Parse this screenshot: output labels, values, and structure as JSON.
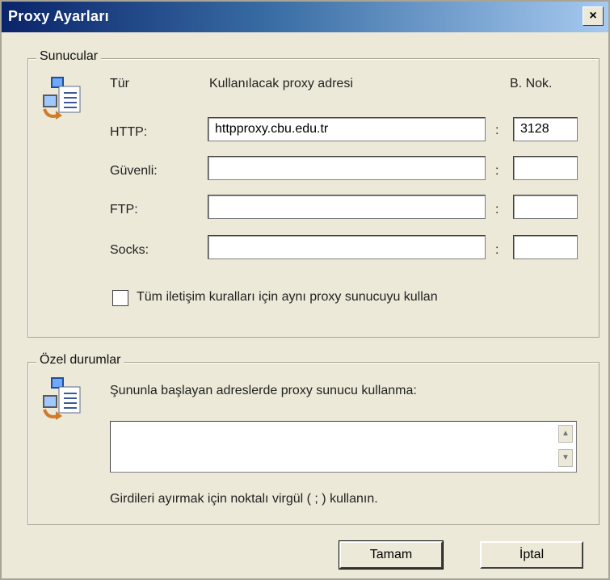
{
  "window": {
    "title": "Proxy Ayarları",
    "close_glyph": "×"
  },
  "servers": {
    "legend": "Sunucular",
    "icon": "proxy-settings-icon",
    "headers": {
      "type": "Tür",
      "address": "Kullanılacak proxy adresi",
      "port": "B. Nok."
    },
    "rows": [
      {
        "label": "HTTP:",
        "address": "httpproxy.cbu.edu.tr",
        "port": "3128"
      },
      {
        "label": "Güvenli:",
        "address": "",
        "port": ""
      },
      {
        "label": "FTP:",
        "address": "",
        "port": ""
      },
      {
        "label": "Socks:",
        "address": "",
        "port": ""
      }
    ],
    "separator": ":",
    "same_proxy_label": "Tüm iletişim kuralları için aynı proxy sunucuyu kullan",
    "same_proxy_checked": false
  },
  "exceptions": {
    "legend": "Özel durumlar",
    "icon": "proxy-exceptions-icon",
    "description": "Şununla başlayan adreslerde proxy sunucu kullanma:",
    "value": "",
    "hint": "Girdileri ayırmak için noktalı virgül ( ; ) kullanın."
  },
  "buttons": {
    "ok": "Tamam",
    "cancel": "İptal"
  }
}
